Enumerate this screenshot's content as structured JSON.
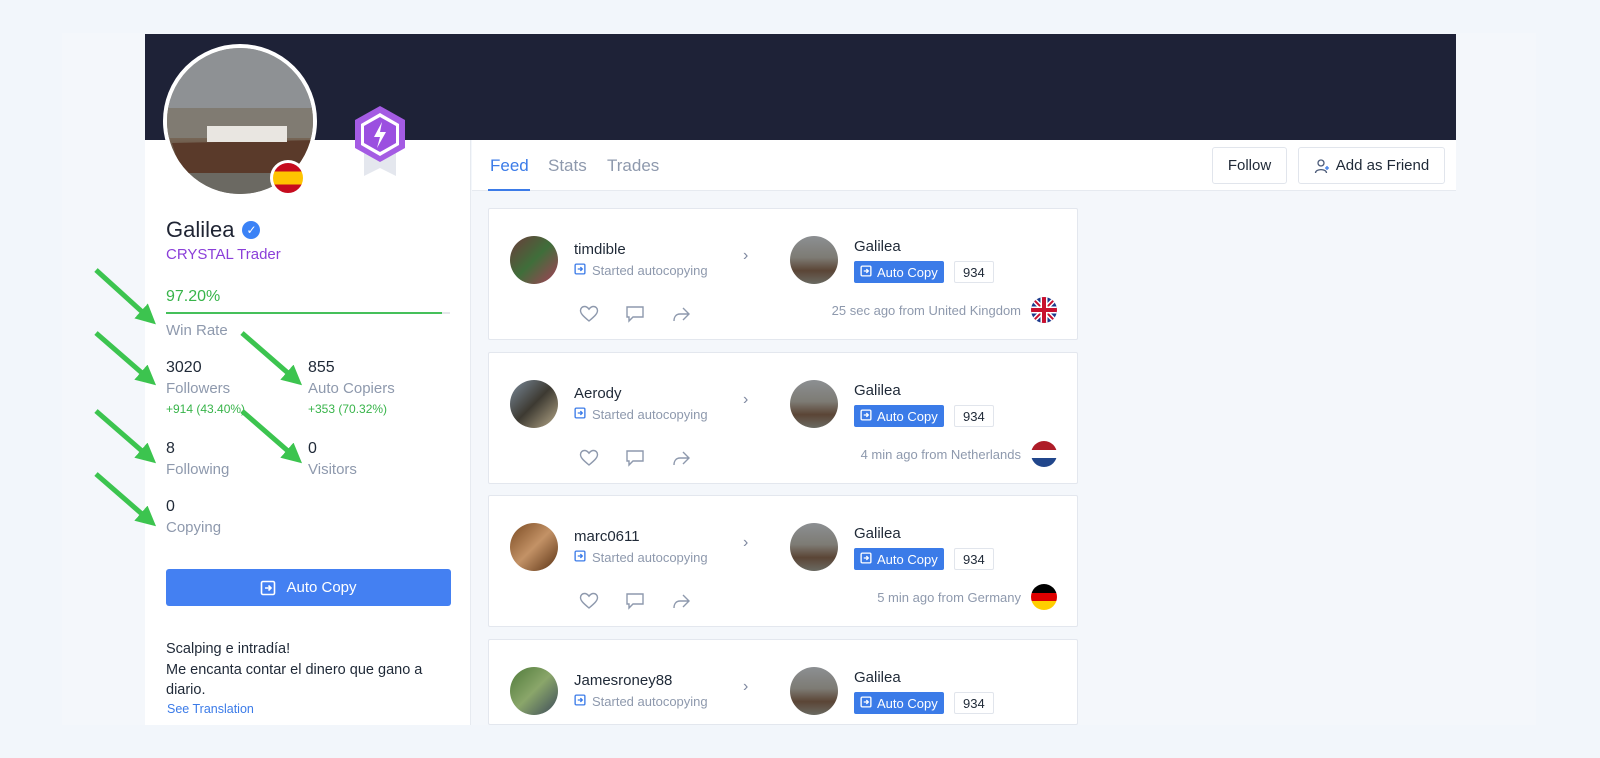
{
  "profile": {
    "name": "Galilea",
    "rank": "CRYSTAL Trader",
    "win_rate_text": "97.20%",
    "win_rate_fraction": 0.972,
    "win_rate_label": "Win Rate",
    "followers": {
      "value": "3020",
      "label": "Followers",
      "delta": "+914 (43.40%)"
    },
    "auto_copiers": {
      "value": "855",
      "label": "Auto Copiers",
      "delta": "+353 (70.32%)"
    },
    "following": {
      "value": "8",
      "label": "Following"
    },
    "visitors": {
      "value": "0",
      "label": "Visitors"
    },
    "copying": {
      "value": "0",
      "label": "Copying"
    },
    "auto_copy_label": "Auto Copy",
    "bio_line1": "Scalping e intradía!",
    "bio_line2": "Me encanta contar el dinero que gano a diario.",
    "see_translation": "See Translation"
  },
  "tabs": [
    "Feed",
    "Stats",
    "Trades"
  ],
  "actions": {
    "follow": "Follow",
    "add_friend": "Add as Friend"
  },
  "feed": [
    {
      "user": "timdible",
      "action": "Started autocopying",
      "target": "Galilea",
      "button": "Auto Copy",
      "count": "934",
      "meta": "25 sec ago from United Kingdom",
      "flag": "uk"
    },
    {
      "user": "Aerody",
      "action": "Started autocopying",
      "target": "Galilea",
      "button": "Auto Copy",
      "count": "934",
      "meta": "4 min ago from Netherlands",
      "flag": "nl"
    },
    {
      "user": "marc0611",
      "action": "Started autocopying",
      "target": "Galilea",
      "button": "Auto Copy",
      "count": "934",
      "meta": "5 min ago from Germany",
      "flag": "de"
    },
    {
      "user": "Jamesroney88",
      "action": "Started autocopying",
      "target": "Galilea",
      "button": "Auto Copy",
      "count": "934",
      "meta": "",
      "flag": ""
    }
  ],
  "colors": {
    "accent": "#3b7be8",
    "banner": "#1e2237",
    "rank": "#8b3fd9",
    "positive": "#38b44a",
    "annotation_arrow": "#3cc44f"
  }
}
